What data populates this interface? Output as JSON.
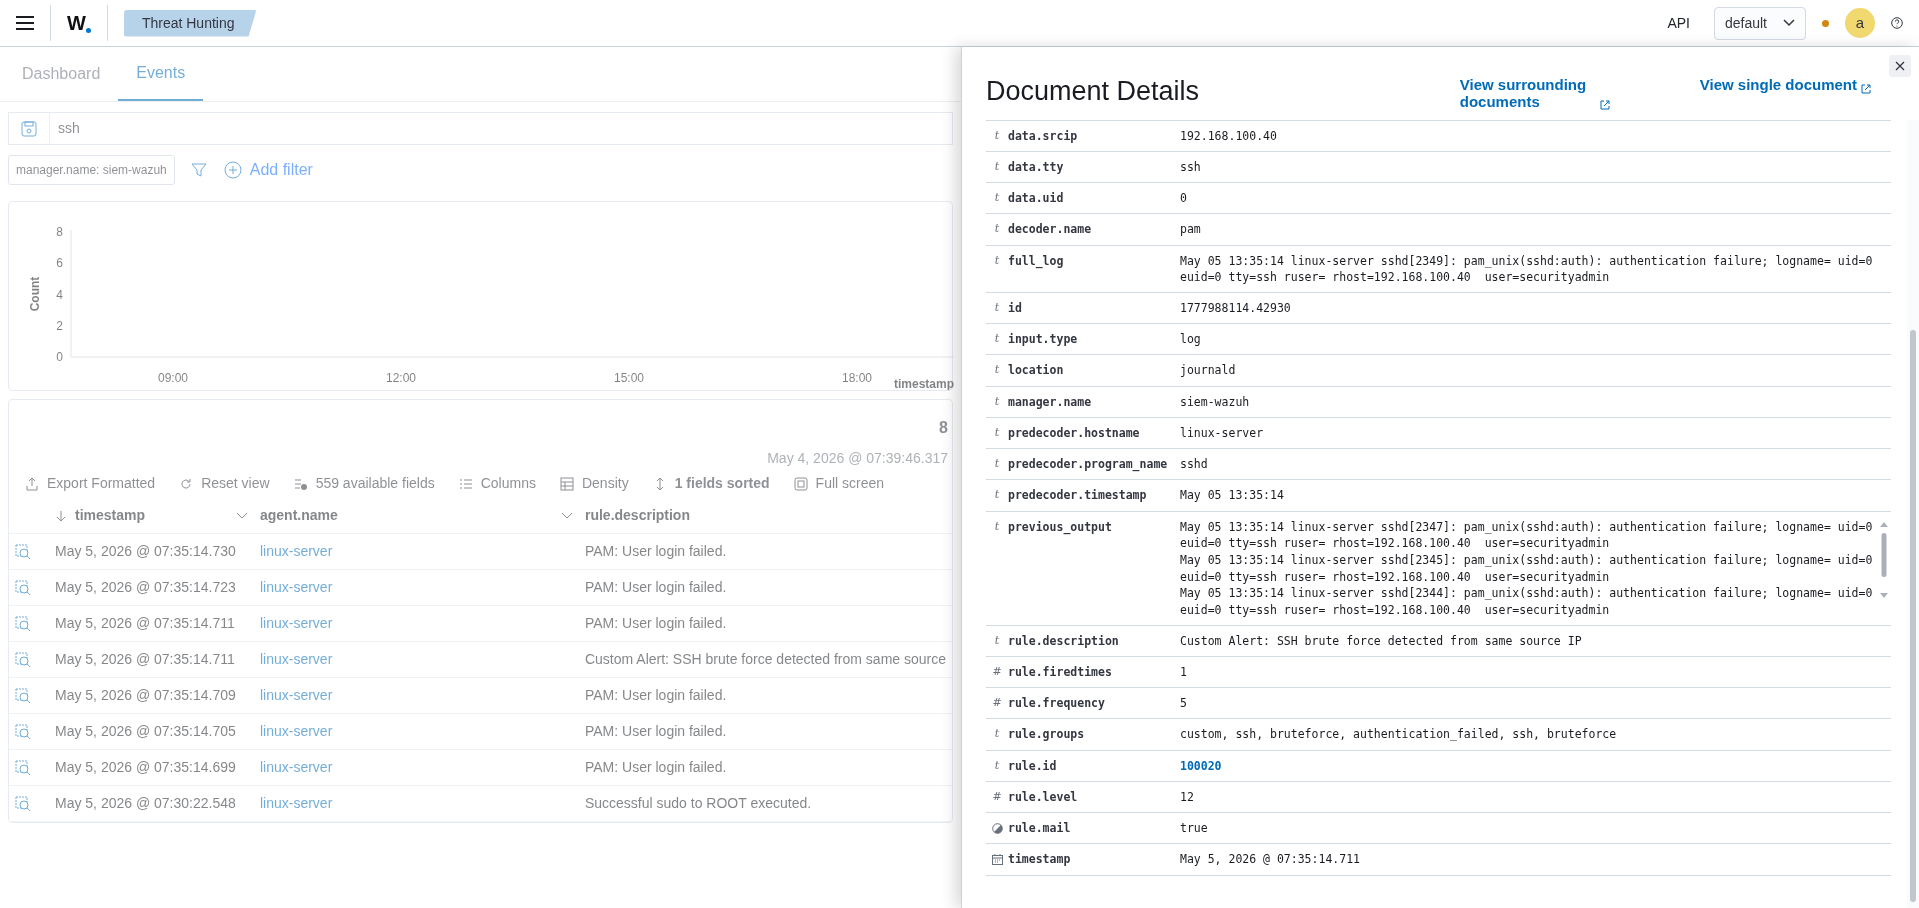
{
  "header": {
    "breadcrumb": "Threat Hunting",
    "logo": "W",
    "api_link": "API",
    "tenant_select": "default",
    "avatar": "a"
  },
  "tabs": [
    {
      "label": "Dashboard",
      "selected": false
    },
    {
      "label": "Events",
      "selected": true
    }
  ],
  "query": "ssh",
  "filters": [
    {
      "label": "manager.name: siem-wazuh"
    }
  ],
  "add_filter": "Add filter",
  "histogram": {
    "chart_data": {
      "type": "bar",
      "xlabel": "timestamp",
      "ylabel": "Count",
      "categories": [
        "09:00",
        "12:00",
        "15:00",
        "18:00"
      ],
      "values": [
        0,
        0,
        0,
        0
      ],
      "ylim": [
        0,
        8
      ],
      "yticks": [
        0,
        2,
        4,
        6,
        8
      ]
    }
  },
  "results": {
    "hits": "8",
    "time_range": "May 4, 2026 @ 07:39:46.317",
    "toolbar": [
      "Export Formatted",
      "Reset view",
      "559 available fields",
      "Columns",
      "Density",
      "1 fields sorted",
      "Full screen"
    ],
    "columns": [
      "timestamp",
      "agent.name",
      "rule.description"
    ],
    "rows": [
      {
        "timestamp": "May 5, 2026 @ 07:35:14.730",
        "agent": "linux-server",
        "description": "PAM: User login failed."
      },
      {
        "timestamp": "May 5, 2026 @ 07:35:14.723",
        "agent": "linux-server",
        "description": "PAM: User login failed."
      },
      {
        "timestamp": "May 5, 2026 @ 07:35:14.711",
        "agent": "linux-server",
        "description": "PAM: User login failed."
      },
      {
        "timestamp": "May 5, 2026 @ 07:35:14.711",
        "agent": "linux-server",
        "description": "Custom Alert: SSH brute force detected from same source"
      },
      {
        "timestamp": "May 5, 2026 @ 07:35:14.709",
        "agent": "linux-server",
        "description": "PAM: User login failed."
      },
      {
        "timestamp": "May 5, 2026 @ 07:35:14.705",
        "agent": "linux-server",
        "description": "PAM: User login failed."
      },
      {
        "timestamp": "May 5, 2026 @ 07:35:14.699",
        "agent": "linux-server",
        "description": "PAM: User login failed."
      },
      {
        "timestamp": "May 5, 2026 @ 07:30:22.548",
        "agent": "linux-server",
        "description": "Successful sudo to ROOT executed."
      }
    ]
  },
  "flyout": {
    "title": "Document Details",
    "links": [
      "View surrounding documents",
      "View single document"
    ],
    "fields": [
      {
        "kind": "string",
        "glyph": "t",
        "name": "data.srcip",
        "value": "192.168.100.40"
      },
      {
        "kind": "string",
        "glyph": "t",
        "name": "data.tty",
        "value": "ssh"
      },
      {
        "kind": "string",
        "glyph": "t",
        "name": "data.uid",
        "value": "0"
      },
      {
        "kind": "string",
        "glyph": "t",
        "name": "decoder.name",
        "value": "pam"
      },
      {
        "kind": "string",
        "glyph": "t",
        "name": "full_log",
        "value": "May 05 13:35:14 linux-server sshd[2349]: pam_unix(sshd:auth): authentication failure; logname= uid=0 euid=0 tty=ssh ruser= rhost=192.168.100.40  user=securityadmin"
      },
      {
        "kind": "string",
        "glyph": "t",
        "name": "id",
        "value": "1777988114.42930"
      },
      {
        "kind": "string",
        "glyph": "t",
        "name": "input.type",
        "value": "log"
      },
      {
        "kind": "string",
        "glyph": "t",
        "name": "location",
        "value": "journald"
      },
      {
        "kind": "string",
        "glyph": "t",
        "name": "manager.name",
        "value": "siem-wazuh"
      },
      {
        "kind": "string",
        "glyph": "t",
        "name": "predecoder.hostname",
        "value": "linux-server"
      },
      {
        "kind": "string",
        "glyph": "t",
        "name": "predecoder.program_name",
        "value": "sshd"
      },
      {
        "kind": "string",
        "glyph": "t",
        "name": "predecoder.timestamp",
        "value": "May 05 13:35:14"
      },
      {
        "kind": "string",
        "glyph": "t",
        "name": "previous_output",
        "scroll": true,
        "value": "May 05 13:35:14 linux-server sshd[2347]: pam_unix(sshd:auth): authentication failure; logname= uid=0 euid=0 tty=ssh ruser= rhost=192.168.100.40  user=securityadmin\nMay 05 13:35:14 linux-server sshd[2345]: pam_unix(sshd:auth): authentication failure; logname= uid=0 euid=0 tty=ssh ruser= rhost=192.168.100.40  user=securityadmin\nMay 05 13:35:14 linux-server sshd[2344]: pam_unix(sshd:auth): authentication failure; logname= uid=0 euid=0 tty=ssh ruser= rhost=192.168.100.40  user=securityadmin"
      },
      {
        "kind": "string",
        "glyph": "t",
        "name": "rule.description",
        "value": "Custom Alert: SSH brute force detected from same source IP"
      },
      {
        "kind": "number",
        "glyph": "#",
        "name": "rule.firedtimes",
        "value": "1"
      },
      {
        "kind": "number",
        "glyph": "#",
        "name": "rule.frequency",
        "value": "5"
      },
      {
        "kind": "string",
        "glyph": "t",
        "name": "rule.groups",
        "value": "custom, ssh, bruteforce, authentication_failed, ssh, bruteforce"
      },
      {
        "kind": "string",
        "glyph": "t",
        "name": "rule.id",
        "value": "100020",
        "link": true
      },
      {
        "kind": "number",
        "glyph": "#",
        "name": "rule.level",
        "value": "12"
      },
      {
        "kind": "boolean",
        "name": "rule.mail",
        "value": "true"
      },
      {
        "kind": "date",
        "name": "timestamp",
        "value": "May 5, 2026 @ 07:35:14.711"
      }
    ]
  }
}
